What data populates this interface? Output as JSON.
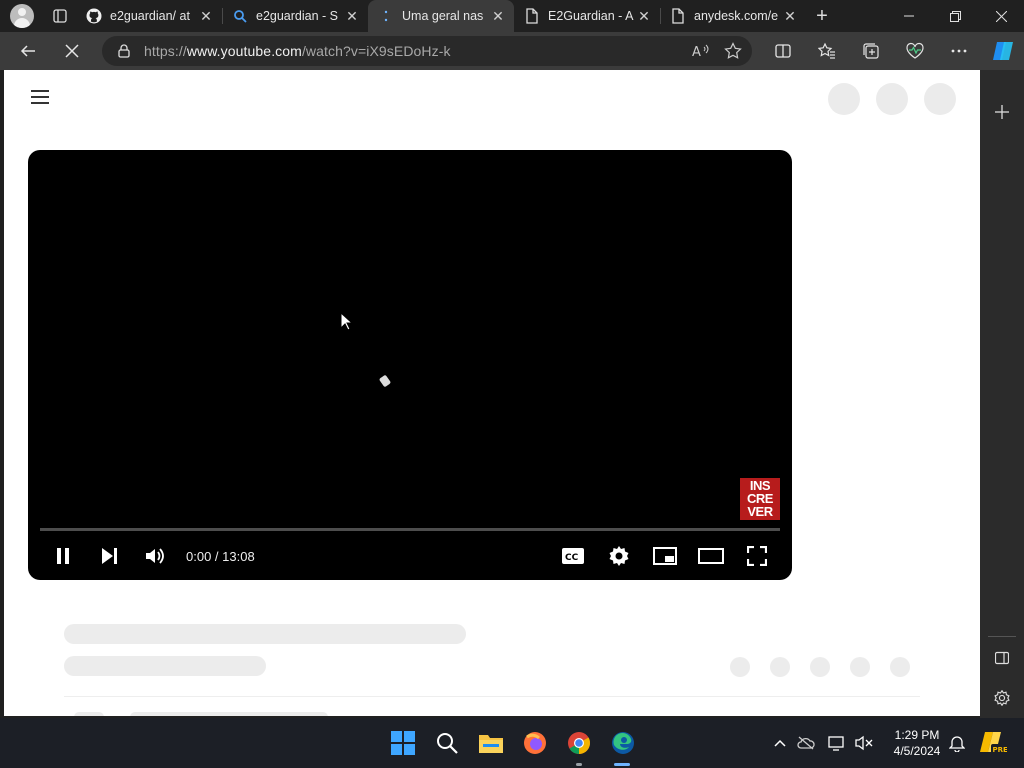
{
  "browser": {
    "tabs": [
      {
        "title": "e2guardian/ at",
        "icon": "github-icon",
        "active": false
      },
      {
        "title": "e2guardian - S",
        "icon": "search-icon",
        "active": false
      },
      {
        "title": "Uma geral nas",
        "icon": "loading-icon",
        "active": true
      },
      {
        "title": "E2Guardian - A",
        "icon": "document-icon",
        "active": false
      },
      {
        "title": "anydesk.com/e",
        "icon": "document-icon",
        "active": false
      }
    ],
    "address": {
      "prefix": "https://",
      "host": "www.youtube.com",
      "path": "/watch?v=iX9sEDoHz-k"
    }
  },
  "player": {
    "time_display": "0:00 / 13:08",
    "progress": 0,
    "watermark": [
      "INS",
      "CRE",
      "VER"
    ]
  },
  "taskbar": {
    "time": "1:29 PM",
    "date": "4/5/2024",
    "copilot_badge": "PRE"
  },
  "colors": {
    "chrome_bg": "#202020",
    "toolbar_bg": "#3b3b3b",
    "accent": "#6fb4ff",
    "watermark_red": "#b71c1c"
  }
}
